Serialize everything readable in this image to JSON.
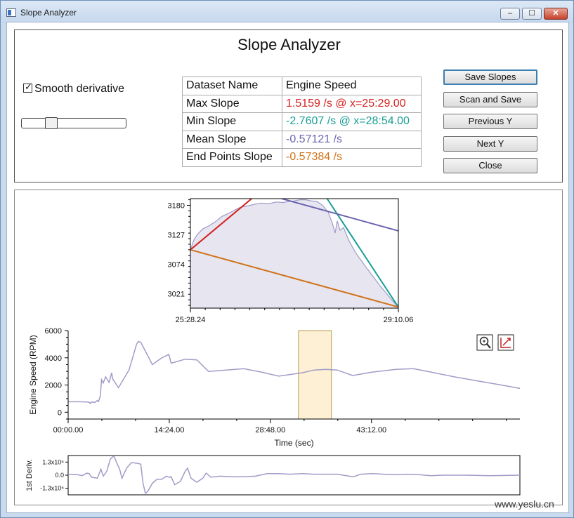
{
  "window": {
    "title": "Slope Analyzer",
    "minimize": "–",
    "maximize": "☐",
    "close": "✕"
  },
  "header": {
    "title": "Slope Analyzer"
  },
  "controls": {
    "smooth_label": "Smooth derivative",
    "smooth_checked": true,
    "slider_value": 0.25
  },
  "table": {
    "rows": [
      {
        "label": "Dataset Name",
        "value": "Engine Speed",
        "color": "#111111"
      },
      {
        "label": "Max Slope",
        "value": "1.5159 /s @ x=25:29.00",
        "color": "#d62020"
      },
      {
        "label": "Min Slope",
        "value": "-2.7607 /s @ x=28:54.00",
        "color": "#1a9e96"
      },
      {
        "label": "Mean Slope",
        "value": "-0.57121 /s",
        "color": "#6a64b0"
      },
      {
        "label": "End Points Slope",
        "value": "-0.57384 /s",
        "color": "#d0731a"
      }
    ]
  },
  "buttons": {
    "save_slopes": "Save Slopes",
    "scan_and_save": "Scan and Save",
    "previous_y": "Previous Y",
    "next_y": "Next Y",
    "close": "Close"
  },
  "icons": {
    "zoom": "zoom-icon",
    "rescale": "rescale-icon"
  },
  "colors": {
    "max": "#d62020",
    "min": "#1a9e96",
    "mean": "#6a64b0",
    "end": "#d0731a",
    "curve": "#a09cc8",
    "fill": "#e6e5f0",
    "highlight": "#fdf0d4",
    "highlight_border": "#b89a55"
  },
  "chart_data": [
    {
      "type": "area",
      "name": "zoom",
      "xlim_labels": [
        "25:28.24",
        "29:10.06"
      ],
      "ylim": [
        2995,
        3192
      ],
      "yticks": [
        3021,
        3074,
        3127,
        3180
      ],
      "x": [
        0,
        5,
        10,
        18,
        25,
        35,
        45,
        55,
        70,
        85,
        100,
        112,
        122,
        132,
        140,
        148,
        156,
        164,
        172,
        180,
        188,
        196,
        202,
        206,
        209,
        213,
        218,
        225,
        235,
        248,
        260,
        270,
        280,
        290,
        296
      ],
      "y": [
        3100,
        3118,
        3128,
        3138,
        3142,
        3150,
        3160,
        3166,
        3176,
        3180,
        3184,
        3183,
        3186,
        3185,
        3187,
        3188,
        3190,
        3190,
        3188,
        3187,
        3180,
        3168,
        3148,
        3130,
        3152,
        3135,
        3140,
        3118,
        3095,
        3072,
        3052,
        3035,
        3020,
        3005,
        2997
      ],
      "lines": [
        {
          "key": "max",
          "p1": [
            0,
            3100
          ],
          "p2": [
            90,
            3195
          ]
        },
        {
          "key": "min",
          "p1": [
            193,
            3195
          ],
          "p2": [
            296,
            2997
          ]
        },
        {
          "key": "mean",
          "p1": [
            130,
            3192
          ],
          "p2": [
            296,
            3134
          ]
        },
        {
          "key": "end",
          "p1": [
            0,
            3100
          ],
          "p2": [
            296,
            2997
          ]
        }
      ],
      "xmax": 296
    },
    {
      "type": "line",
      "name": "engine-speed",
      "xlabel": "Time (sec)",
      "ylabel": "Engine Speed (RPM)",
      "ylim": [
        -500,
        6000
      ],
      "yticks": [
        0,
        2000,
        4000,
        6000
      ],
      "xticks": [
        "00:00.00",
        "14:24.00",
        "28:48.00",
        "43:12.00"
      ],
      "xtick_pos": [
        0,
        864,
        1728,
        2592
      ],
      "xmax": 3860,
      "highlight": [
        1968,
        2250
      ],
      "x": [
        0,
        80,
        160,
        180,
        190,
        200,
        228,
        250,
        260,
        275,
        285,
        300,
        320,
        350,
        372,
        380,
        430,
        520,
        585,
        600,
        620,
        720,
        800,
        860,
        880,
        1000,
        1100,
        1200,
        1350,
        1500,
        1650,
        1800,
        2000,
        2100,
        2200,
        2300,
        2430,
        2600,
        2800,
        2950,
        3100,
        3300,
        3500,
        3700,
        3860
      ],
      "y": [
        770,
        770,
        760,
        730,
        640,
        760,
        720,
        860,
        790,
        1200,
        2400,
        2150,
        2600,
        2200,
        2900,
        2450,
        1800,
        3100,
        5000,
        5200,
        5150,
        3500,
        4000,
        4250,
        3600,
        3900,
        3850,
        3000,
        3100,
        3200,
        2950,
        2650,
        2900,
        3100,
        3150,
        3100,
        2700,
        2950,
        3150,
        3200,
        2950,
        2600,
        2300,
        2000,
        1750
      ]
    },
    {
      "type": "line",
      "name": "derivative",
      "ylabel": "1st Deriv.",
      "ylim": [
        -1.95,
        1.95
      ],
      "yticks_labels": [
        "1.3x10⁶",
        "0.0",
        "-1.3x10⁶"
      ],
      "yticks": [
        1.3,
        0,
        -1.3
      ],
      "xmax": 3860,
      "x": [
        0,
        80,
        120,
        160,
        180,
        200,
        250,
        280,
        300,
        330,
        360,
        390,
        420,
        440,
        460,
        500,
        540,
        580,
        620,
        640,
        660,
        680,
        700,
        720,
        760,
        800,
        840,
        860,
        880,
        910,
        960,
        1000,
        1020,
        1050,
        1100,
        1150,
        1180,
        1220,
        1300,
        1400,
        1500,
        1600,
        1700,
        1800,
        1900,
        2000,
        2100,
        2200,
        2300,
        2400,
        2440,
        2500,
        2600,
        2700,
        2800,
        2900,
        3000,
        3100,
        3200,
        3400,
        3600,
        3860
      ],
      "y": [
        0.1,
        0.05,
        -0.05,
        0.2,
        0.15,
        -0.2,
        -0.3,
        0.6,
        -0.1,
        0.4,
        1.6,
        1.9,
        1.1,
        0.6,
        -0.3,
        0.7,
        1.25,
        1.2,
        1.1,
        -0.8,
        -1.8,
        -1.6,
        -1.2,
        -0.8,
        -0.4,
        -0.4,
        -0.1,
        -0.2,
        -0.15,
        -0.95,
        -0.6,
        0.4,
        0.7,
        -0.3,
        -0.7,
        -0.3,
        0.2,
        -0.2,
        -0.1,
        -0.15,
        -0.15,
        -0.1,
        0.15,
        0.15,
        0.1,
        0.15,
        0.1,
        0.1,
        0.1,
        -0.1,
        -0.15,
        0.1,
        0.15,
        0.1,
        0.05,
        0.1,
        0.05,
        -0.05,
        0.0,
        0.0,
        -0.05,
        0.0
      ]
    }
  ],
  "watermark": "www.yeslu.cn"
}
